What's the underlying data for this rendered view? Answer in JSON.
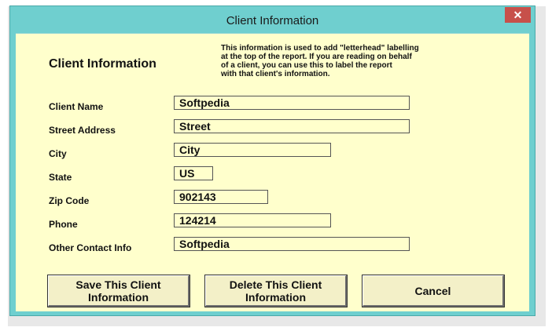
{
  "window": {
    "title": "Client Information",
    "close_glyph": "✕"
  },
  "form": {
    "heading": "Client Information",
    "note": "This information is used to add \"letterhead\" labelling\nat the top of the report.  If you are reading on behalf\nof a client, you can use this to label the report\nwith that client's information.",
    "fields": [
      {
        "label": "Client Name",
        "value": "Softpedia"
      },
      {
        "label": "Street Address",
        "value": "Street"
      },
      {
        "label": "City",
        "value": "City"
      },
      {
        "label": "State",
        "value": "US"
      },
      {
        "label": "Zip Code",
        "value": "902143"
      },
      {
        "label": "Phone",
        "value": "124214"
      },
      {
        "label": "Other Contact Info",
        "value": "Softpedia"
      }
    ]
  },
  "buttons": {
    "save": "Save This Client\nInformation",
    "delete": "Delete This Client\nInformation",
    "cancel": "Cancel"
  },
  "colors": {
    "frame": "#6fcfcf",
    "client_area": "#ffffcc",
    "close_button": "#c7504a",
    "button_face": "#f3f0c8"
  }
}
